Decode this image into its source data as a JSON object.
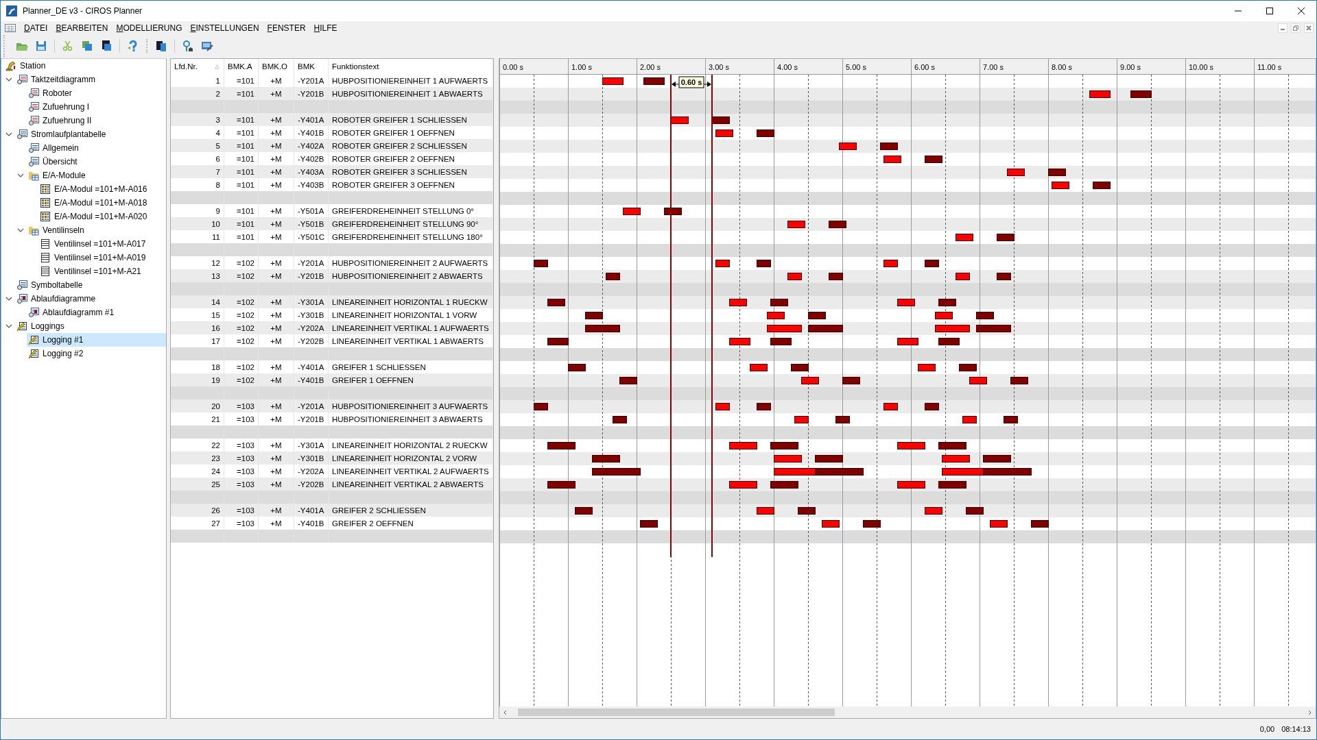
{
  "window": {
    "title": "Planner_DE v3 - CIROS Planner"
  },
  "menu": [
    "DATEI",
    "BEARBEITEN",
    "MODELLIERUNG",
    "EINSTELLUNGEN",
    "FENSTER",
    "HILFE"
  ],
  "tree": [
    {
      "label": "Station",
      "kind": "station",
      "selected": false,
      "children": [
        {
          "label": "Taktzeitdiagramm",
          "kind": "diagram",
          "selected": false,
          "expanded": true,
          "children": [
            {
              "label": "Roboter",
              "kind": "diagram",
              "selected": false
            },
            {
              "label": "Zufuehrung I",
              "kind": "diagram",
              "selected": false
            },
            {
              "label": "Zufuehrung II",
              "kind": "diagram",
              "selected": false
            }
          ]
        },
        {
          "label": "Stromlaufplantabelle",
          "kind": "table",
          "selected": false,
          "expanded": true,
          "children": [
            {
              "label": "Allgemein",
              "kind": "table",
              "selected": false
            },
            {
              "label": "Übersicht",
              "kind": "table",
              "selected": false
            },
            {
              "label": "E/A-Module",
              "kind": "folder",
              "selected": false,
              "expanded": true,
              "children": [
                {
                  "label": "E/A-Modul =101+M-A016",
                  "kind": "module",
                  "selected": false
                },
                {
                  "label": "E/A-Modul =101+M-A018",
                  "kind": "module",
                  "selected": false
                },
                {
                  "label": "E/A-Modul =101+M-A020",
                  "kind": "module",
                  "selected": false
                }
              ]
            },
            {
              "label": "Ventilinseln",
              "kind": "folder",
              "selected": false,
              "expanded": true,
              "children": [
                {
                  "label": "Ventilinsel =101+M-A017",
                  "kind": "list",
                  "selected": false
                },
                {
                  "label": "Ventilinsel =101+M-A019",
                  "kind": "list",
                  "selected": false
                },
                {
                  "label": "Ventilinsel =101+M-A21",
                  "kind": "list",
                  "selected": false
                }
              ]
            }
          ]
        },
        {
          "label": "Symboltabelle",
          "kind": "table",
          "selected": false
        },
        {
          "label": "Ablaufdiagramme",
          "kind": "flowchart",
          "selected": false,
          "expanded": true,
          "children": [
            {
              "label": "Ablaufdiagramm #1",
              "kind": "flowchart",
              "selected": false
            }
          ]
        },
        {
          "label": "Loggings",
          "kind": "log",
          "selected": false,
          "expanded": true,
          "children": [
            {
              "label": "Logging #1",
              "kind": "log",
              "selected": true
            },
            {
              "label": "Logging #2",
              "kind": "log",
              "selected": false
            }
          ]
        }
      ]
    }
  ],
  "table": {
    "columns": [
      "Lfd.Nr.",
      "BMK.A",
      "BMK.O",
      "BMK",
      "Funktionstext"
    ],
    "rows": [
      {
        "kind": "signal",
        "cells": [
          "1",
          "=101",
          "+M",
          "-Y201A",
          "HUBPOSITIONIEREINHEIT 1 AUFWAERTS"
        ]
      },
      {
        "kind": "signal",
        "cells": [
          "2",
          "=101",
          "+M",
          "-Y201B",
          "HUBPOSITIONIEREINHEIT 1 ABWAERTS"
        ]
      },
      {
        "kind": "blank"
      },
      {
        "kind": "signal",
        "cells": [
          "3",
          "=101",
          "+M",
          "-Y401A",
          "ROBOTER GREIFER 1 SCHLIESSEN"
        ]
      },
      {
        "kind": "signal",
        "cells": [
          "4",
          "=101",
          "+M",
          "-Y401B",
          "ROBOTER GREIFER 1 OEFFNEN"
        ]
      },
      {
        "kind": "signal",
        "cells": [
          "5",
          "=101",
          "+M",
          "-Y402A",
          "ROBOTER GREIFER 2 SCHLIESSEN"
        ]
      },
      {
        "kind": "signal",
        "cells": [
          "6",
          "=101",
          "+M",
          "-Y402B",
          "ROBOTER GREIFER 2 OEFFNEN"
        ]
      },
      {
        "kind": "signal",
        "cells": [
          "7",
          "=101",
          "+M",
          "-Y403A",
          "ROBOTER GREIFER 3 SCHLIESSEN"
        ]
      },
      {
        "kind": "signal",
        "cells": [
          "8",
          "=101",
          "+M",
          "-Y403B",
          "ROBOTER GREIFER 3 OEFFNEN"
        ]
      },
      {
        "kind": "blank"
      },
      {
        "kind": "signal",
        "cells": [
          "9",
          "=101",
          "+M",
          "-Y501A",
          "GREIFERDREHEINHEIT STELLUNG 0°"
        ]
      },
      {
        "kind": "signal",
        "cells": [
          "10",
          "=101",
          "+M",
          "-Y501B",
          "GREIFERDREHEINHEIT STELLUNG 90°"
        ]
      },
      {
        "kind": "signal",
        "cells": [
          "11",
          "=101",
          "+M",
          "-Y501C",
          "GREIFERDREHEINHEIT STELLUNG 180°"
        ]
      },
      {
        "kind": "blank"
      },
      {
        "kind": "signal",
        "cells": [
          "12",
          "=102",
          "+M",
          "-Y201A",
          "HUBPOSITIONIEREINHEIT 2 AUFWAERTS"
        ]
      },
      {
        "kind": "signal",
        "cells": [
          "13",
          "=102",
          "+M",
          "-Y201B",
          "HUBPOSITIONIEREINHEIT 2 ABWAERTS"
        ]
      },
      {
        "kind": "blank"
      },
      {
        "kind": "signal",
        "cells": [
          "14",
          "=102",
          "+M",
          "-Y301A",
          "LINEAREINHEIT HORIZONTAL 1 RUECKW"
        ]
      },
      {
        "kind": "signal",
        "cells": [
          "15",
          "=102",
          "+M",
          "-Y301B",
          "LINEAREINHEIT HORIZONTAL 1 VORW"
        ]
      },
      {
        "kind": "signal",
        "cells": [
          "16",
          "=102",
          "+M",
          "-Y202A",
          "LINEAREINHEIT VERTIKAL 1 AUFWAERTS"
        ]
      },
      {
        "kind": "signal",
        "cells": [
          "17",
          "=102",
          "+M",
          "-Y202B",
          "LINEAREINHEIT VERTIKAL 1 ABWAERTS"
        ]
      },
      {
        "kind": "blank"
      },
      {
        "kind": "signal",
        "cells": [
          "18",
          "=102",
          "+M",
          "-Y401A",
          "GREIFER 1 SCHLIESSEN"
        ]
      },
      {
        "kind": "signal",
        "cells": [
          "19",
          "=102",
          "+M",
          "-Y401B",
          "GREIFER 1 OEFFNEN"
        ]
      },
      {
        "kind": "blank"
      },
      {
        "kind": "signal",
        "cells": [
          "20",
          "=103",
          "+M",
          "-Y201A",
          "HUBPOSITIONIEREINHEIT 3 AUFWAERTS"
        ]
      },
      {
        "kind": "signal",
        "cells": [
          "21",
          "=103",
          "+M",
          "-Y201B",
          "HUBPOSITIONIEREINHEIT 3 ABWAERTS"
        ]
      },
      {
        "kind": "blank"
      },
      {
        "kind": "signal",
        "cells": [
          "22",
          "=103",
          "+M",
          "-Y301A",
          "LINEAREINHEIT HORIZONTAL 2 RUECKW"
        ]
      },
      {
        "kind": "signal",
        "cells": [
          "23",
          "=103",
          "+M",
          "-Y301B",
          "LINEAREINHEIT HORIZONTAL 2 VORW"
        ]
      },
      {
        "kind": "signal",
        "cells": [
          "24",
          "=103",
          "+M",
          "-Y202A",
          "LINEAREINHEIT VERTIKAL 2 AUFWAERTS"
        ]
      },
      {
        "kind": "signal",
        "cells": [
          "25",
          "=103",
          "+M",
          "-Y202B",
          "LINEAREINHEIT VERTIKAL 2 ABWAERTS"
        ]
      },
      {
        "kind": "blank"
      },
      {
        "kind": "signal",
        "cells": [
          "26",
          "=103",
          "+M",
          "-Y401A",
          "GREIFER 2 SCHLIESSEN"
        ]
      },
      {
        "kind": "signal",
        "cells": [
          "27",
          "=103",
          "+M",
          "-Y401B",
          "GREIFER 2 OEFFNEN"
        ]
      },
      {
        "kind": "blank"
      }
    ]
  },
  "timing_diagram": {
    "time_axis": [
      "0.00 s",
      "1.00 s",
      "2.00 s",
      "3.00 s",
      "4.00 s",
      "5.00 s",
      "6.00 s",
      "7.00 s",
      "8.00 s",
      "9.00 s",
      "10.00 s",
      "11.00 s"
    ],
    "measure_label": "0.60 s"
  },
  "status_bar": [
    "0,00",
    "08:14:13"
  ]
}
